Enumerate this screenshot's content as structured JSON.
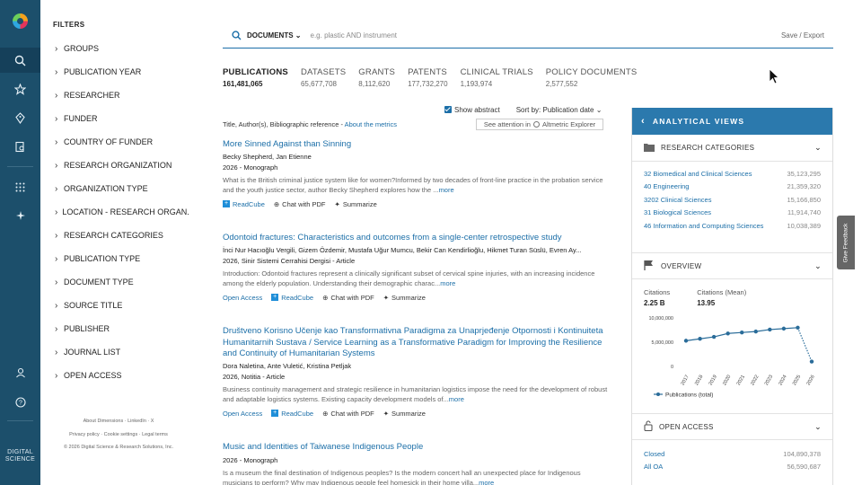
{
  "brand": "DIGITAL SCIENCE",
  "rail_icons": [
    "dimensions-logo-icon",
    "search-icon",
    "star-icon",
    "tag-icon",
    "document-search-icon",
    "grid-icon",
    "sparkle-icon",
    "user-icon",
    "help-icon"
  ],
  "filters": {
    "title": "FILTERS",
    "items": [
      "GROUPS",
      "PUBLICATION YEAR",
      "RESEARCHER",
      "FUNDER",
      "COUNTRY OF FUNDER",
      "RESEARCH ORGANIZATION",
      "ORGANIZATION TYPE",
      "LOCATION - RESEARCH ORGAN...",
      "RESEARCH CATEGORIES",
      "PUBLICATION TYPE",
      "DOCUMENT TYPE",
      "SOURCE TITLE",
      "PUBLISHER",
      "JOURNAL LIST",
      "OPEN ACCESS"
    ]
  },
  "footer": {
    "line1": "About Dimensions · LinkedIn · X",
    "line2": "Privacy policy · Cookie settings · Legal terms",
    "line3": "© 2026 Digital Science & Research Solutions, Inc."
  },
  "search": {
    "scope": "DOCUMENTS",
    "placeholder": "e.g. plastic AND instrument",
    "save_export": "Save / Export"
  },
  "counts": [
    {
      "label": "PUBLICATIONS",
      "value": "161,481,065"
    },
    {
      "label": "DATASETS",
      "value": "65,677,708"
    },
    {
      "label": "GRANTS",
      "value": "8,112,620"
    },
    {
      "label": "PATENTS",
      "value": "177,732,270"
    },
    {
      "label": "CLINICAL TRIALS",
      "value": "1,193,974"
    },
    {
      "label": "POLICY DOCUMENTS",
      "value": "2,577,552"
    }
  ],
  "toolbar": {
    "show_abstract": "Show abstract",
    "sort_by": "Sort by:",
    "sort_value": "Publication date"
  },
  "meta": {
    "text": "Title, Author(s), Bibliographic reference - ",
    "link": "About the metrics",
    "attention": "See attention in",
    "altmetric": "Altmetric Explorer"
  },
  "results": [
    {
      "title": "More Sinned Against than Sinning",
      "authors": "Becky Shepherd, Jan Etienne",
      "sub": "2026 - Monograph",
      "abstract": "What is the British criminal justice system like for women?Informed by two decades of front-line practice in the probation service and the youth justice sector, author Becky Shepherd explores how the ...",
      "more": "more",
      "open_access": "",
      "actions": [
        "ReadCube",
        "Chat with PDF",
        "Summarize"
      ]
    },
    {
      "title": "Odontoid fractures: Characteristics and outcomes from a single-center retrospective study",
      "authors": "İnci Nur Hacıoğlu Vergili, Gizem Özdemir, Mustafa Uğur Mumcu, Bekir Can Kendirlioğlu, Hikmet Turan Süslü, Evren Ay...",
      "sub": "2026, Sinir Sistemi Cerrahisi Dergisi - Article",
      "abstract": "Introduction: Odontoid fractures represent a clinically significant subset of cervical spine injuries, with an increasing incidence among the elderly population. Understanding their demographic charac...",
      "more": "more",
      "open_access": "Open Access",
      "actions": [
        "ReadCube",
        "Chat with PDF",
        "Summarize"
      ]
    },
    {
      "title": "Društveno Korisno Učenje kao Transformativna Paradigma za Unaprjeđenje Otpornosti i Kontinuiteta Humanitarnih Sustava / Service Learning as a Transformative Paradigm for Improving the Resilience and Continuity of Humanitarian Systems",
      "authors": "Dora Naletina, Ante Vuletić, Kristina Petljak",
      "sub": "2026, Notitia - Article",
      "abstract": "Business continuity management and strategic resilience in humanitarian logistics impose the need for the development of robust and adaptable logistics systems. Existing capacity development models of...",
      "more": "more",
      "open_access": "Open Access",
      "actions": [
        "ReadCube",
        "Chat with PDF",
        "Summarize"
      ]
    },
    {
      "title": "Music and Identities of Taiwanese Indigenous People",
      "authors": "",
      "sub": "2026 - Monograph",
      "abstract": "Is a museum the final destination of Indigenous peoples? Is the modern concert hall an unexpected place for Indigenous musicians to perform? Why may Indigenous people feel homesick in their home villa...",
      "more": "more",
      "open_access": "",
      "actions": []
    }
  ],
  "panel": {
    "title": "ANALYTICAL VIEWS",
    "research_categories": {
      "title": "RESEARCH CATEGORIES",
      "rows": [
        {
          "name": "32 Biomedical and Clinical Sciences",
          "value": "35,123,295"
        },
        {
          "name": "40 Engineering",
          "value": "21,359,320"
        },
        {
          "name": "3202 Clinical Sciences",
          "value": "15,166,850"
        },
        {
          "name": "31 Biological Sciences",
          "value": "11,914,740"
        },
        {
          "name": "46 Information and Computing Sciences",
          "value": "10,038,389"
        }
      ]
    },
    "overview": {
      "title": "OVERVIEW",
      "citations_label": "Citations",
      "citations_value": "2.25 B",
      "mean_label": "Citations (Mean)",
      "mean_value": "13.95"
    },
    "open_access": {
      "title": "OPEN ACCESS",
      "rows": [
        {
          "name": "Closed",
          "value": "104,890,378"
        },
        {
          "name": "All OA",
          "value": "56,590,687"
        }
      ]
    }
  },
  "chart_data": {
    "type": "line",
    "x": [
      "2017",
      "2018",
      "2019",
      "2020",
      "2021",
      "2022",
      "2023",
      "2024",
      "2025",
      "2026"
    ],
    "series": [
      {
        "name": "Publications (total)",
        "values": [
          5300000,
          5700000,
          6100000,
          6800000,
          7000000,
          7200000,
          7600000,
          7800000,
          8000000,
          1000000
        ]
      }
    ],
    "yticks": [
      "10,000,000",
      "5,000,000",
      "0"
    ],
    "ylim": [
      0,
      10000000
    ],
    "legend": "bottom-left",
    "grid": false
  },
  "feedback": "Give Feedback"
}
